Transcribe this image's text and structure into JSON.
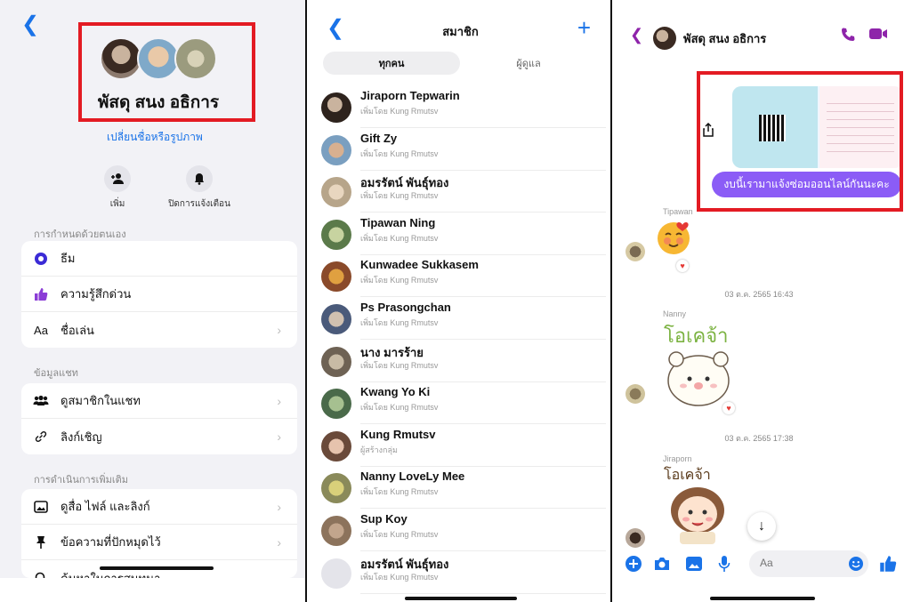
{
  "panel1": {
    "group_name": "พัสดุ สนง อธิการ",
    "change_link": "เปลี่ยนชื่อหรือรูปภาพ",
    "actions": [
      {
        "label": "เพิ่ม",
        "icon": "add-person-icon"
      },
      {
        "label": "ปิดการแจ้งเตือน",
        "icon": "bell-icon"
      }
    ],
    "sections": {
      "customize": "การกำหนดด้วยตนเอง",
      "chat_info": "ข้อมูลแชท",
      "more_actions": "การดำเนินการเพิ่มเติม"
    },
    "customize_items": [
      {
        "label": "ธีม",
        "icon": "theme-icon"
      },
      {
        "label": "ความรู้สึกด่วน",
        "icon": "thumbs-up-icon"
      },
      {
        "label": "ชื่อเล่น",
        "icon": "nickname-icon",
        "icon_text": "Aa"
      }
    ],
    "chat_info_items": [
      {
        "label": "ดูสมาชิกในแชท",
        "icon": "members-icon"
      },
      {
        "label": "ลิงก์เชิญ",
        "icon": "link-icon"
      }
    ],
    "more_items": [
      {
        "label": "ดูสื่อ ไฟล์ และลิงก์",
        "icon": "media-icon"
      },
      {
        "label": "ข้อความที่ปักหมุดไว้",
        "icon": "pin-icon"
      },
      {
        "label": "ค้นหาในการสนทนา",
        "icon": "search-icon"
      }
    ]
  },
  "panel2": {
    "title": "สมาชิก",
    "tabs": [
      "ทุกคน",
      "ผู้ดูแล"
    ],
    "members": [
      {
        "name": "Jiraporn Tepwarin",
        "sub": "เพิ่มโดย Kung Rmutsv"
      },
      {
        "name": "Gift Zy",
        "sub": "เพิ่มโดย Kung Rmutsv"
      },
      {
        "name": "อมรรัตน์ พันธุ์ทอง",
        "sub": "เพิ่มโดย Kung Rmutsv"
      },
      {
        "name": "Tipawan Ning",
        "sub": "เพิ่มโดย Kung Rmutsv"
      },
      {
        "name": "Kunwadee Sukkasem",
        "sub": "เพิ่มโดย Kung Rmutsv"
      },
      {
        "name": "Ps Prasongchan",
        "sub": "เพิ่มโดย Kung Rmutsv"
      },
      {
        "name": "นาง มารร้าย",
        "sub": "เพิ่มโดย Kung Rmutsv"
      },
      {
        "name": "Kwang Yo Ki",
        "sub": "เพิ่มโดย Kung Rmutsv"
      },
      {
        "name": "Kung Rmutsv",
        "sub": "ผู้สร้างกลุ่ม"
      },
      {
        "name": "Nanny LoveLy Mee",
        "sub": "เพิ่มโดย Kung Rmutsv"
      },
      {
        "name": "Sup Koy",
        "sub": "เพิ่มโดย Kung Rmutsv"
      },
      {
        "name": "อมรรัตน์ พันธุ์ทอง",
        "sub": "เพิ่มโดย Kung Rmutsv"
      }
    ]
  },
  "panel3": {
    "chat_name": "พัสดุ สนง อธิการ",
    "message_text": "งบนี้เรามาแจ้งซ่อมออนไลน์กันนะคะ",
    "sender_tipawan": "Tipawan",
    "timestamp1": "03 ต.ค. 2565 16:43",
    "sender_nanny": "Nanny",
    "sticker_text_nanny": "โอเคจ้า",
    "timestamp2": "03 ต.ค. 2565 17:38",
    "sender_jiraporn": "Jiraporn",
    "sticker_text_jiraporn": "โอเคจ้า",
    "composer_placeholder": "Aa"
  },
  "colors": {
    "accent_blue": "#1a73e8",
    "highlight_red": "#e31b23",
    "bubble_purple": "#8b5cf6",
    "call_purple": "#8e24aa"
  }
}
